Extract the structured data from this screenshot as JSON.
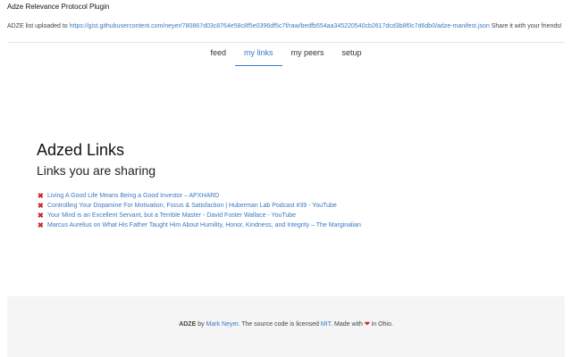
{
  "app": {
    "title": "Adze Relevance Protocol Plugin"
  },
  "upload": {
    "prefix": "ADZE list uploaded to ",
    "url": "https://gist.githubusercontent.com/neyer/780867d03c8764e58c8f5e0396df5c7f/raw/bedfb554aa345220540cb2617dcd3b8f0c7d6db0/adze-manifest.json",
    "suffix": " Share it with your friends!"
  },
  "tabs": [
    {
      "label": "feed",
      "active": false
    },
    {
      "label": "my links",
      "active": true
    },
    {
      "label": "my peers",
      "active": false
    },
    {
      "label": "setup",
      "active": false
    }
  ],
  "main": {
    "title": "Adzed Links",
    "subtitle": "Links you are sharing",
    "links": [
      {
        "label": "Living A Good Life Means Being a Good Investor – APXHARD"
      },
      {
        "label": "Controlling Your Dopamine For Motivation, Focus & Satisfaction | Huberman Lab Podcast #39 - YouTube"
      },
      {
        "label": "Your Mind is an Excellent Servant, but a Terrible Master - David Foster Wallace - YouTube"
      },
      {
        "label": "Marcus Aurelius on What His Father Taught Him About Humility, Honor, Kindness, and Integrity – The Marginalian"
      }
    ]
  },
  "footer": {
    "brand": "ADZE",
    "by": " by ",
    "author": "Mark Neyer",
    "mid": ". The source code is licensed ",
    "license": "MIT",
    "made": ". Made with ",
    "heart": "❤",
    "end": " in Ohio."
  },
  "colors": {
    "link": "#3b78c4",
    "remove_icon": "#c62828",
    "footer_bg": "#f5f5f5"
  },
  "icons": {
    "remove": "x-icon",
    "heart": "heart-icon"
  }
}
